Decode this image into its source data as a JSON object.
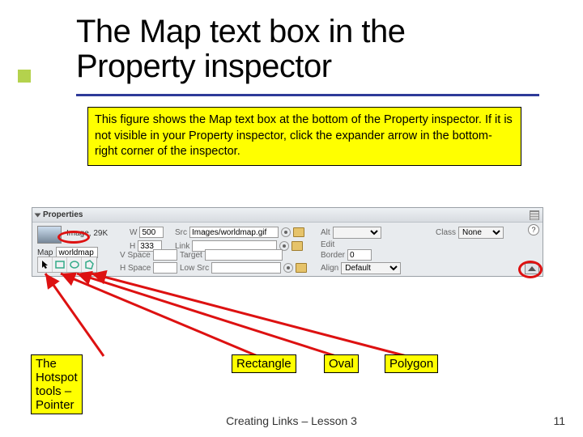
{
  "title": "The Map text box in the Property inspector",
  "caption": "This figure shows the Map text box at the bottom of the Property inspector. If it is not visible in your Property inspector, click the expander arrow in the bottom-right corner of the inspector.",
  "inspector": {
    "panel_title": "Properties",
    "image_label": "Image, 29K",
    "w_label": "W",
    "w_value": "500",
    "h_label": "H",
    "h_value": "333",
    "src_label": "Src",
    "src_value": "Images/worldmap.gif",
    "link_label": "Link",
    "link_value": "",
    "alt_label": "Alt",
    "alt_value": "",
    "edit_label": "Edit",
    "class_label": "Class",
    "class_value": "None",
    "map_label": "Map",
    "map_value": "worldmap",
    "vspace_label": "V Space",
    "vspace_value": "",
    "hspace_label": "H Space",
    "hspace_value": "",
    "target_label": "Target",
    "target_value": "",
    "lowsrc_label": "Low Src",
    "lowsrc_value": "",
    "border_label": "Border",
    "border_value": "0",
    "align_label": "Align",
    "align_value": "Default",
    "help_char": "?"
  },
  "annotations": {
    "pointer": "The Hotspot tools – Pointer",
    "rectangle": "Rectangle",
    "oval": "Oval",
    "polygon": "Polygon"
  },
  "footer": "Creating Links – Lesson 3",
  "page_number": "11"
}
